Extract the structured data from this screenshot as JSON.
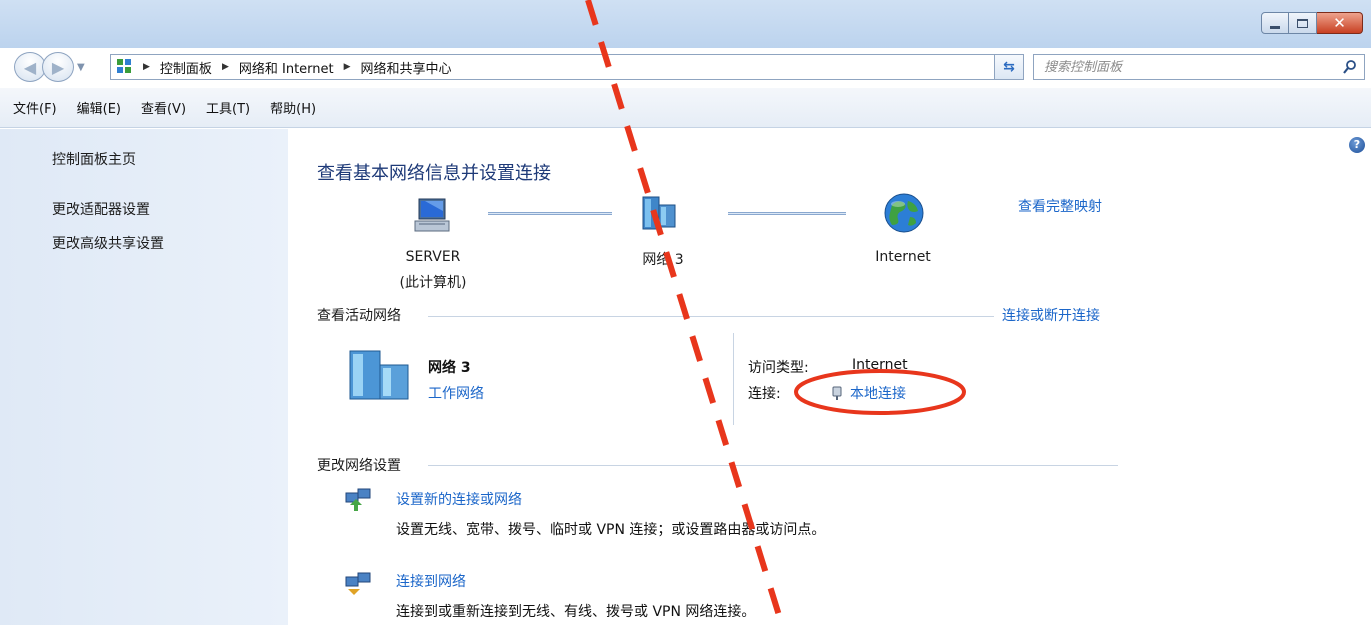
{
  "window": {
    "caption_buttons": {
      "minimize": "minimize",
      "maximize": "maximize",
      "close": "close"
    }
  },
  "address": {
    "breadcrumbs": [
      "控制面板",
      "网络和 Internet",
      "网络和共享中心"
    ],
    "search_placeholder": "搜索控制面板"
  },
  "menu": [
    "文件(F)",
    "编辑(E)",
    "查看(V)",
    "工具(T)",
    "帮助(H)"
  ],
  "sidebar": {
    "items": [
      "控制面板主页",
      "更改适配器设置",
      "更改高级共享设置"
    ]
  },
  "main": {
    "title": "查看基本网络信息并设置连接",
    "see_full_map": "查看完整映射",
    "map": {
      "computer_name": "SERVER",
      "computer_sub": "(此计算机)",
      "network": "网络  3",
      "internet": "Internet"
    },
    "active_networks": {
      "heading": "查看活动网络",
      "connect_disconnect": "连接或断开连接",
      "network_name": "网络  3",
      "network_type": "工作网络",
      "access_type_label": "访问类型:",
      "access_type_value": "Internet",
      "connections_label": "连接:",
      "connections_value": "本地连接"
    },
    "change_settings": {
      "heading": "更改网络设置",
      "tasks": [
        {
          "title": "设置新的连接或网络",
          "desc": "设置无线、宽带、拨号、临时或 VPN 连接；或设置路由器或访问点。"
        },
        {
          "title": "连接到网络",
          "desc": "连接到或重新连接到无线、有线、拨号或 VPN 网络连接。"
        }
      ]
    }
  },
  "colors": {
    "link": "#1b66c9",
    "title": "#1e3a78",
    "annotation": "#e8361c"
  },
  "icons": {
    "computer": "computer-icon",
    "network": "network-icon",
    "internet": "globe-icon",
    "plug": "plug-icon",
    "help": "help-icon"
  }
}
